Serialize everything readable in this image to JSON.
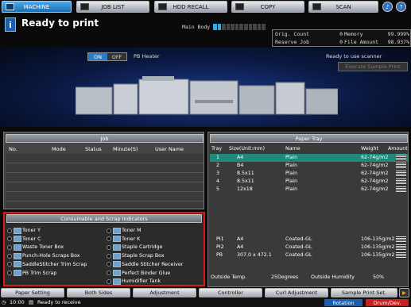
{
  "tabs": {
    "machine": "MACHINE",
    "job_list": "JOB LIST",
    "hdd_recall": "HDD RECALL",
    "copy": "COPY",
    "scan": "SCAN"
  },
  "status": {
    "message": "Ready to print",
    "main_body_label": "Main Body",
    "main_body_level": 0.2
  },
  "counts": {
    "orig_count_label": "Orig. Count",
    "orig_count_value": "0",
    "reserve_job_label": "Reserve Job",
    "reserve_job_value": "0",
    "memory_label": "Memory",
    "memory_value": "99.999%",
    "file_amount_label": "File Amount",
    "file_amount_value": "98.937%"
  },
  "machine": {
    "toggle_on": "ON",
    "toggle_off": "OFF",
    "pb_heater": "PB Heater",
    "scanner_status": "Ready to use scanner",
    "execute_sample": "Execute Sample Print"
  },
  "job": {
    "title": "Job",
    "columns": [
      "No.",
      "Mode",
      "Status",
      "Minute(S)",
      "User Name"
    ]
  },
  "consumables": {
    "title": "Consumable and Scrap Indicators",
    "left": [
      "Toner Y",
      "Toner C",
      "Waste Toner Box",
      "Punch-Hole Scraps Box",
      "SaddleStitcher Trim Scrap",
      "PB Trim Scrap"
    ],
    "right": [
      "Toner M",
      "Toner K",
      "Staple Cartridge",
      "Staple Scrap Box",
      "Saddle Stitcher Receiver",
      "Perfect Binder Glue",
      "Humidifier Tank"
    ]
  },
  "tray": {
    "title": "Paper Tray",
    "columns": [
      "Tray",
      "Size(Unit:mm)",
      "Name",
      "Weight",
      "Amount"
    ],
    "rows": [
      {
        "tray": "1",
        "size": "A4",
        "name": "Plain",
        "weight": "62-74g/m2"
      },
      {
        "tray": "2",
        "size": "B4",
        "name": "Plain",
        "weight": "62-74g/m2"
      },
      {
        "tray": "3",
        "size": "8.5x11",
        "name": "Plain",
        "weight": "62-74g/m2"
      },
      {
        "tray": "4",
        "size": "8.5x11",
        "name": "Plain",
        "weight": "62-74g/m2"
      },
      {
        "tray": "5",
        "size": "12x18",
        "name": "Plain",
        "weight": "62-74g/m2"
      }
    ],
    "extra_rows": [
      {
        "tray": "PI1",
        "size": "A4",
        "name": "Coated-GL",
        "weight": "106-135g/m2"
      },
      {
        "tray": "PI2",
        "size": "A4",
        "name": "Coated-GL",
        "weight": "106-135g/m2"
      },
      {
        "tray": "PB",
        "size": "307.0 x 472.1",
        "name": "Coated-GL",
        "weight": "106-135g/m2"
      }
    ],
    "outside_temp_label": "Outside Temp.",
    "outside_temp_value": "25Degrees",
    "outside_humidity_label": "Outside Humidity",
    "outside_humidity_value": "50%"
  },
  "bottom_buttons": [
    "Paper Setting",
    "Both Sides",
    "Adjustment",
    "Controller",
    "Curl Adjustment",
    "Sample Print Set."
  ],
  "statusbar": {
    "time": "10:00",
    "message": "Ready to receive",
    "rotation": "Rotation",
    "drum": "Drum/Dev."
  }
}
